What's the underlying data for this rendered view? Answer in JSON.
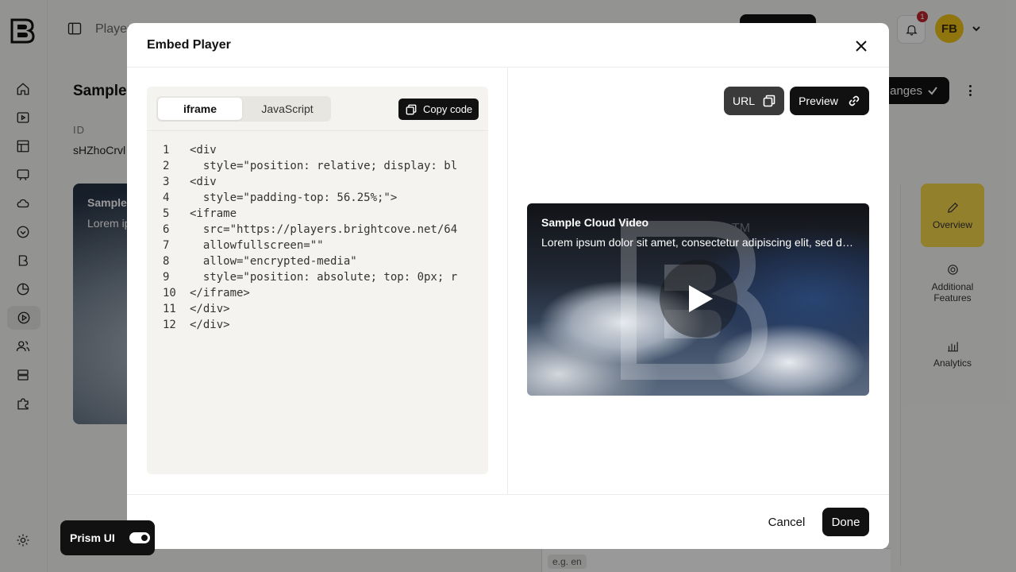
{
  "app": {
    "breadcrumb": "Player",
    "page_title": "Sample",
    "id_label": "ID",
    "id_value": "sHZhoCrvl",
    "thumbnail": {
      "title": "Sample",
      "description": "Lorem ip"
    },
    "save_label": "anges",
    "notification_count": "1",
    "avatar_initials": "FB",
    "side_tabs": [
      {
        "label": "Overview",
        "icon": "pencil-icon"
      },
      {
        "label": "Additional Features",
        "icon": "gear-icon"
      },
      {
        "label": "Analytics",
        "icon": "bar-chart-icon"
      }
    ],
    "language_placeholder": "e.g. en"
  },
  "prism": {
    "label": "Prism UI",
    "enabled": true
  },
  "modal": {
    "title": "Embed Player",
    "tabs": [
      {
        "label": "iframe",
        "active": true
      },
      {
        "label": "JavaScript",
        "active": false
      }
    ],
    "copy_label": "Copy code",
    "code_lines": [
      {
        "n": "1",
        "text": "<div"
      },
      {
        "n": "2",
        "text": "  style=\"position: relative; display: bl"
      },
      {
        "n": "3",
        "text": "<div"
      },
      {
        "n": "4",
        "text": "  style=\"padding-top: 56.25%;\">"
      },
      {
        "n": "5",
        "text": "<iframe"
      },
      {
        "n": "6",
        "text": "  src=\"https://players.brightcove.net/64"
      },
      {
        "n": "7",
        "text": "  allowfullscreen=\"\""
      },
      {
        "n": "8",
        "text": "  allow=\"encrypted-media\""
      },
      {
        "n": "9",
        "text": "  style=\"position: absolute; top: 0px; r"
      },
      {
        "n": "10",
        "text": "</iframe>"
      },
      {
        "n": "11",
        "text": "</div>"
      },
      {
        "n": "12",
        "text": "</div>"
      }
    ],
    "url_label": "URL",
    "preview_label": "Preview",
    "video": {
      "title": "Sample Cloud Video",
      "description": "Lorem ipsum dolor sit amet, consectetur adipiscing elit, sed d…",
      "watermark_mark": "TM"
    },
    "cancel_label": "Cancel",
    "done_label": "Done"
  },
  "colors": {
    "accent": "#f3d54a",
    "dark": "#111111",
    "badge": "#c0262d"
  }
}
